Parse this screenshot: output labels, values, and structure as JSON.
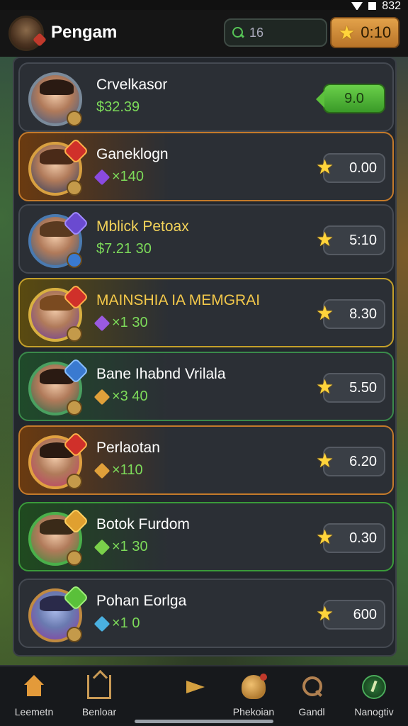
{
  "status_bar": {
    "time": "832"
  },
  "header": {
    "title": "Pengam",
    "search_value": "16",
    "star_balance": "0:10"
  },
  "colors": {
    "accent_gold": "#e3a24a",
    "price_green": "#6ad04a",
    "currency_green": "#7ddb5a"
  },
  "rows": [
    {
      "name": "Crvelkasor",
      "sub": "$32.39",
      "sub_icon": "",
      "price": "9.0",
      "price_style": "green-tag"
    },
    {
      "name": "Ganeklogn",
      "sub": "×140",
      "sub_icon": "purple-gem-icon",
      "price": "0.00",
      "price_style": "star"
    },
    {
      "name": "Mblick Petoax",
      "sub": "$7.21 30",
      "sub_icon": "",
      "price": "5:10",
      "price_style": "star"
    },
    {
      "name": "MAINSHIA IA MEMGRAI",
      "sub": "×1 30",
      "sub_icon": "purple-gem-icon",
      "price": "8.30",
      "price_style": "star"
    },
    {
      "name": "Bane Ihabnd Vrilala",
      "sub": "×3 40",
      "sub_icon": "gold-gem-icon",
      "price": "5.50",
      "price_style": "star"
    },
    {
      "name": "Perlaotan",
      "sub": "×110",
      "sub_icon": "gold-gem-icon",
      "price": "6.20",
      "price_style": "star"
    },
    {
      "name": "Botok Furdom",
      "sub": "×1 30",
      "sub_icon": "green-gem-icon",
      "price": "0.30",
      "price_style": "star"
    },
    {
      "name": "Pohan Eorlga",
      "sub": "×1 0",
      "sub_icon": "blue-gem-icon",
      "price": "600",
      "price_style": "star"
    }
  ],
  "bottom_nav": [
    {
      "label": "Leemetn",
      "icon": "home-icon"
    },
    {
      "label": "Benloar",
      "icon": "build-icon"
    },
    {
      "label": "",
      "icon": "plane-icon"
    },
    {
      "label": "Phekoian",
      "icon": "bag-icon"
    },
    {
      "label": "Gandl",
      "icon": "search-icon"
    },
    {
      "label": "Nanogtiv",
      "icon": "compass-icon"
    }
  ]
}
